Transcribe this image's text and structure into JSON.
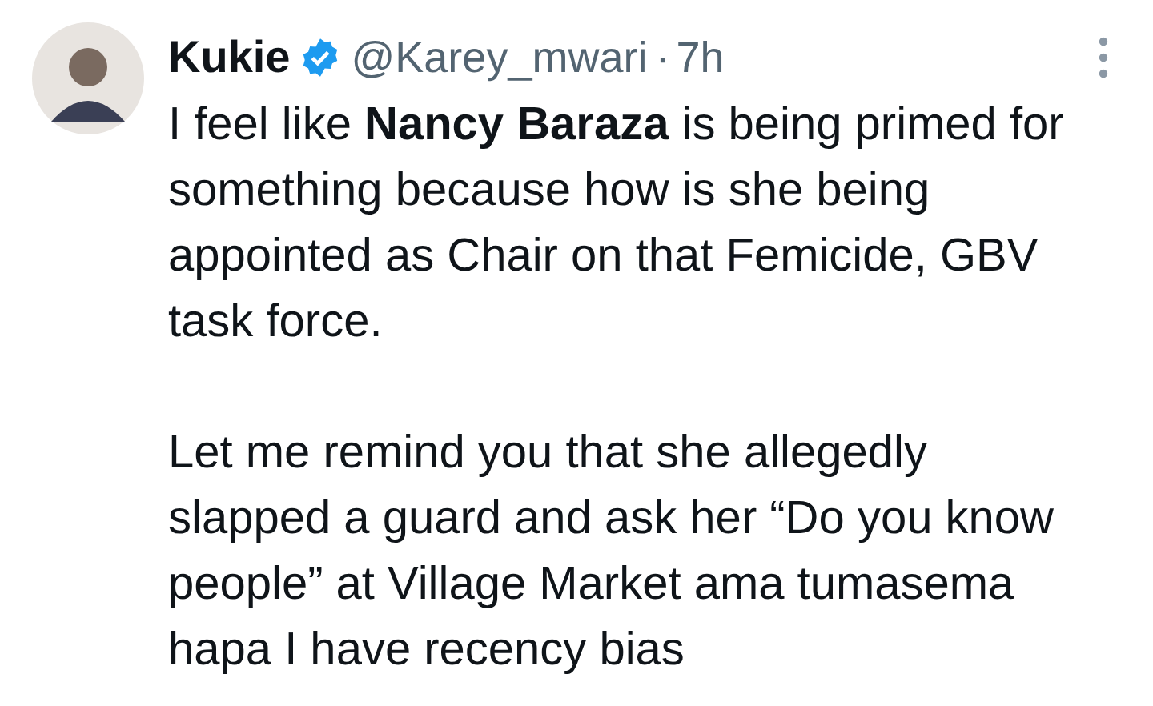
{
  "tweet": {
    "display_name": "Kukie",
    "verified": true,
    "handle": "@Karey_mwari",
    "separator": "·",
    "time": "7h",
    "paragraphs": [
      "I feel like **Nancy Baraza** is being primed for something because how is she being appointed as Chair on that Femicide, GBV task force.",
      "Let me remind you that she allegedly slapped a guard and ask her “Do you know people” at Village Market ama tumasema hapa I have recency bias"
    ]
  }
}
